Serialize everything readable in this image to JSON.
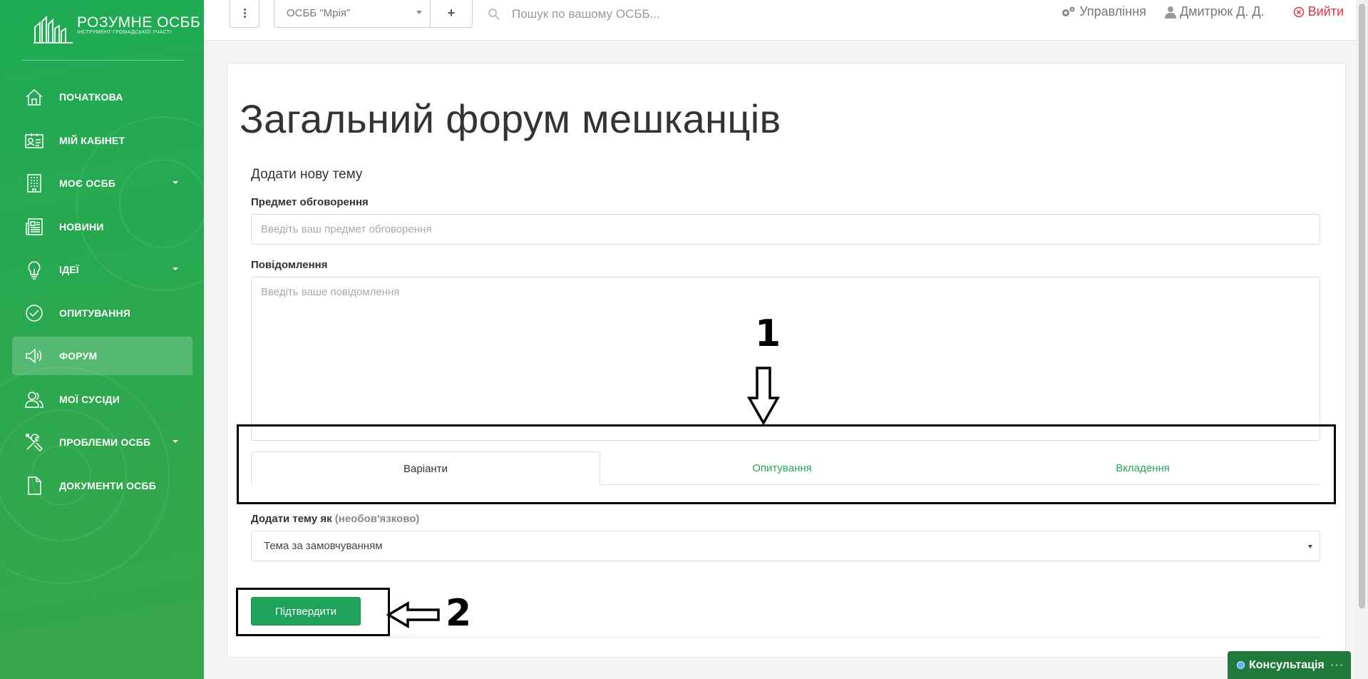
{
  "brand": {
    "name": "РОЗУМНЕ ОСББ",
    "tagline": "ІНСТРУМЕНТ ГРОМАДСЬКОЇ УЧАСТІ"
  },
  "sidebar": {
    "items": [
      {
        "label": "ПОЧАТКОВА",
        "icon": "home-icon"
      },
      {
        "label": "МІЙ КАБІНЕТ",
        "icon": "id-card-icon"
      },
      {
        "label": "МОЄ ОСББ",
        "icon": "building-icon",
        "has_submenu": true
      },
      {
        "label": "НОВИНИ",
        "icon": "newspaper-icon"
      },
      {
        "label": "ІДЕЇ",
        "icon": "lightbulb-icon",
        "has_submenu": true
      },
      {
        "label": "ОПИТУВАННЯ",
        "icon": "check-circle-icon"
      },
      {
        "label": "ФОРУМ",
        "icon": "megaphone-icon",
        "active": true
      },
      {
        "label": "МОЇ СУСІДИ",
        "icon": "users-icon"
      },
      {
        "label": "ПРОБЛЕМИ ОСББ",
        "icon": "tools-icon",
        "has_submenu": true
      },
      {
        "label": "ДОКУМЕНТИ ОСББ",
        "icon": "document-icon"
      }
    ]
  },
  "topbar": {
    "osbb_selected": "ОСББ \"Мрія\"",
    "add_label": "+",
    "search_placeholder": "Пошук по вашому ОСББ...",
    "management_label": "Управління",
    "user_name": "Дмитрюк Д. Д.",
    "logout_label": "Вийти"
  },
  "main": {
    "title": "Загальний форум мешканців",
    "form_heading": "Додати нову тему",
    "subject_label": "Предмет обговорення",
    "subject_placeholder": "Введіть ваш предмет обговорення",
    "message_label": "Повідомлення",
    "message_placeholder": "Введіть ваше повідомлення",
    "tabs": [
      {
        "label": "Варіанти",
        "active": true
      },
      {
        "label": "Опитування"
      },
      {
        "label": "Вкладення"
      }
    ],
    "add_as_label": "Додати тему як",
    "add_as_optional": "(необов'язково)",
    "add_as_value": "Тема за замовчуванням",
    "confirm_label": "Підтвердити"
  },
  "annotations": {
    "marker_1": "1",
    "marker_2": "2"
  },
  "widget": {
    "consult_label": "Консультація",
    "more": "···"
  },
  "colors": {
    "sidebar_green": "#29a84f",
    "accent_green": "#1fa25a",
    "logout_red": "#e8323c"
  }
}
